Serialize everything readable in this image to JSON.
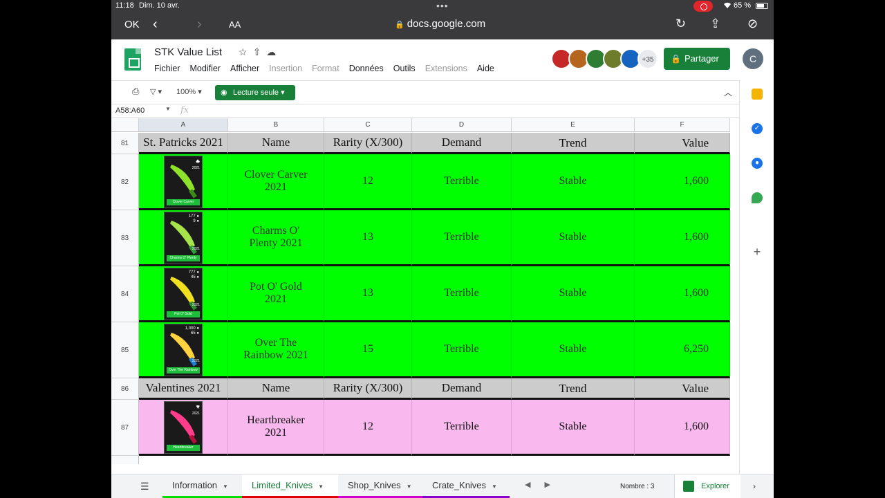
{
  "status": {
    "time": "11:18",
    "date": "Dim. 10 avr.",
    "battery": "65 %"
  },
  "safari": {
    "done": "OK",
    "text_size": "AA",
    "url": "docs.google.com"
  },
  "doc": {
    "title": "STK Value List"
  },
  "menu": [
    "Fichier",
    "Modifier",
    "Afficher",
    "Insertion",
    "Format",
    "Données",
    "Outils",
    "Extensions",
    "Aide"
  ],
  "menu_disabled": [
    "Insertion",
    "Format",
    "Extensions"
  ],
  "collaborators_more": "+35",
  "share_label": "Partager",
  "account_initial": "C",
  "toolbar": {
    "zoom": "100%",
    "view_mode": "Lecture seule"
  },
  "formula": {
    "range": "A58:A60",
    "fx": "fx"
  },
  "columns": [
    "A",
    "B",
    "C",
    "D",
    "E",
    "F"
  ],
  "sections": [
    {
      "row": "81",
      "header": [
        "St. Patricks 2021",
        "Name",
        "Rarity (X/300)",
        "Demand",
        "Trend",
        "Value"
      ],
      "color": "#00ff00",
      "items": [
        {
          "row": "82",
          "thumb_label": "Clover Carver",
          "name": "Clover Carver 2021",
          "rarity": "12",
          "demand": "Terrible",
          "trend": "Stable",
          "value": "1,600"
        },
        {
          "row": "83",
          "thumb_label": "Charms O' Plenty",
          "name": "Charms O' Plenty 2021",
          "rarity": "13",
          "demand": "Terrible",
          "trend": "Stable",
          "value": "1,600"
        },
        {
          "row": "84",
          "thumb_label": "Pot O' Gold",
          "name": "Pot O' Gold 2021",
          "rarity": "13",
          "demand": "Terrible",
          "trend": "Stable",
          "value": "1,600"
        },
        {
          "row": "85",
          "thumb_label": "Over The Rainbow",
          "name": "Over The Rainbow 2021",
          "rarity": "15",
          "demand": "Terrible",
          "trend": "Stable",
          "value": "6,250"
        }
      ]
    },
    {
      "row": "86",
      "header": [
        "Valentines 2021",
        "Name",
        "Rarity (X/300)",
        "Demand",
        "Trend",
        "Value"
      ],
      "color": "#f9b9ef",
      "items": [
        {
          "row": "87",
          "thumb_label": "Heartbreaker",
          "name": "Heartbreaker 2021",
          "rarity": "12",
          "demand": "Terrible",
          "trend": "Stable",
          "value": "1,600"
        }
      ]
    }
  ],
  "thumb_extras": {
    "83": {
      "coins": "177",
      "gems": "9"
    },
    "84": {
      "coins": "777",
      "gems": "45"
    },
    "85": {
      "coins": "1,000",
      "gems": "65"
    }
  },
  "thumb_year": "2021",
  "sheet_tabs": [
    {
      "label": "Information",
      "stripe": "#00e000",
      "active": false
    },
    {
      "label": "Limited_Knives",
      "stripe": "#e00000",
      "active": true
    },
    {
      "label": "Shop_Knives",
      "stripe": "#d000d0",
      "active": false
    },
    {
      "label": "Crate_Knives",
      "stripe": "#8a00d0",
      "active": false
    }
  ],
  "count_label": "Nombre : 3",
  "explore_label": "Explorer",
  "colors": {
    "sheets_green": "#188038",
    "header_gray": "#cccccc"
  }
}
